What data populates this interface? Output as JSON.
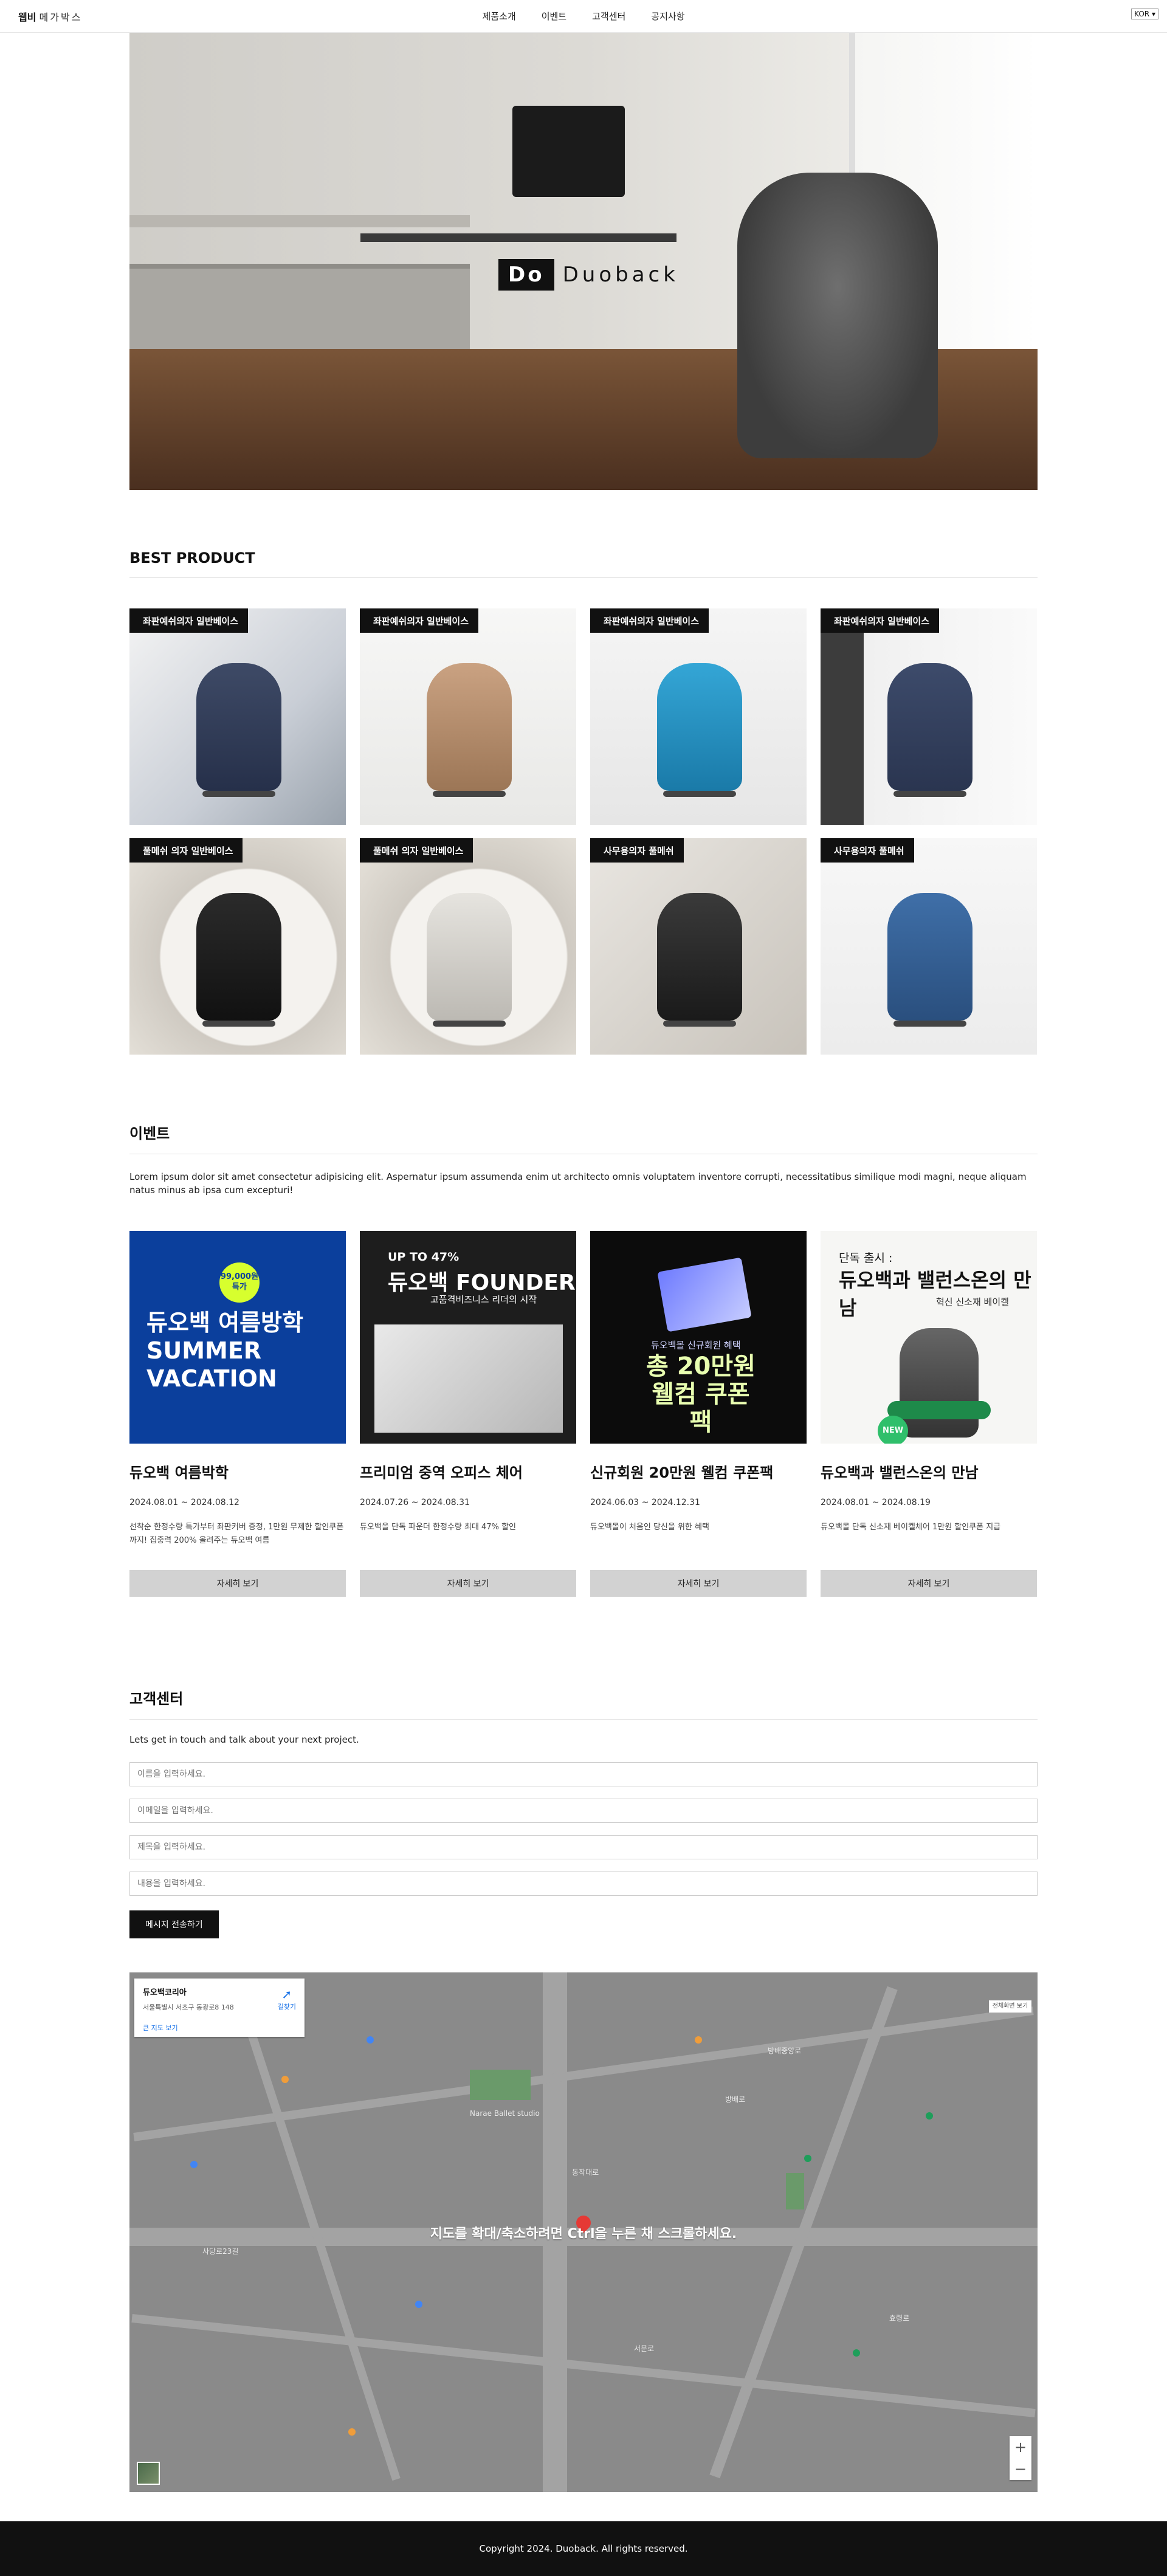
{
  "header": {
    "logo_bold": "웹비",
    "logo_rest": "메가박스",
    "nav": [
      {
        "label": "제품소개"
      },
      {
        "label": "이벤트"
      },
      {
        "label": "고객센터"
      },
      {
        "label": "공지사항"
      }
    ],
    "language": "KOR"
  },
  "hero": {
    "badge_box": "Do",
    "badge_word": "Duoback"
  },
  "best_products": {
    "title": "BEST PRODUCT",
    "items": [
      {
        "tag": "좌판예쉬의자 일반베이스"
      },
      {
        "tag": "좌판예쉬의자 일반베이스"
      },
      {
        "tag": "좌판예쉬의자 일반베이스"
      },
      {
        "tag": "좌판예쉬의자 일반베이스"
      },
      {
        "tag": "풀메쉬 의자 일반베이스"
      },
      {
        "tag": "풀메쉬 의자 일반베이스"
      },
      {
        "tag": "사무용의자 풀메쉬"
      },
      {
        "tag": "사무용의자 풀메쉬"
      }
    ]
  },
  "events": {
    "title": "이벤트",
    "description": "Lorem ipsum dolor sit amet consectetur adipisicing elit. Aspernatur ipsum assumenda enim ut architecto omnis voluptatem inventore corrupti, necessitatibus similique modi magni, neque aliquam natus minus ab ipsa cum excepturi!",
    "items": [
      {
        "title": "듀오백 여름박학",
        "date": "2024.08.01 ~ 2024.08.12",
        "text": "선착순 한정수량 특가부터 좌판커버 증정, 1만원 무제한 할인쿠폰까지! 집중력 200% 올려주는 듀오백 여름",
        "button": "자세히 보기",
        "img_badge": "99,000원 특가",
        "img_big": "듀오백 여름방학 SUMMER VACATION"
      },
      {
        "title": "프리미엄 중역 오피스 체어",
        "date": "2024.07.26 ~ 2024.08.31",
        "text": "듀오백을 단독 파운더 한정수량 최대 47% 할인",
        "button": "자세히 보기",
        "img_top": "UP TO 47%",
        "img_big": "듀오백 FOUNDER",
        "img_sub": "고품격비즈니스 리더의 시작"
      },
      {
        "title": "신규회원 20만원 웰컴 쿠폰팩",
        "date": "2024.06.03 ~ 2024.12.31",
        "text": "듀오백몰이 처음인 당신을 위한 혜택",
        "button": "자세히 보기",
        "img_sub": "듀오백몰 신규회원 혜택",
        "img_big": "총 20만원 웰컴 쿠폰팩"
      },
      {
        "title": "듀오백과 밸런스온의 만남",
        "date": "2024.08.01 ~ 2024.08.19",
        "text": "듀오백몰 단독 신소재 베이켈체어 1만원 할인쿠폰 지급",
        "button": "자세히 보기",
        "img_top": "단독 출시 :",
        "img_big": "듀오백과 밸런스온의 만남",
        "img_sub": "혁신 신소재 베이켈",
        "img_new": "NEW"
      }
    ]
  },
  "customer_center": {
    "title": "고객센터",
    "description": "Lets get in touch and talk about your next project.",
    "fields": [
      {
        "placeholder": "이름을 입력하세요."
      },
      {
        "placeholder": "이메일을 입력하세요."
      },
      {
        "placeholder": "제목을 입력하세요."
      },
      {
        "placeholder": "내용을 입력하세요."
      }
    ],
    "submit": "메시지 전송하기"
  },
  "map": {
    "place_name": "듀오백코리아",
    "address": "서울특별시 서초구 동광로8 148",
    "directions": "길찾기",
    "larger_map": "큰 지도 보기",
    "overlay": "지도를 확대/축소하려면 Ctrl을 누른 채 스크롤하세요.",
    "fullscreen": "전체화면 보기",
    "zoom_in": "+",
    "zoom_out": "−",
    "labels": [
      {
        "text": "Narae Ballet studio"
      },
      {
        "text": "동작대로"
      },
      {
        "text": "방배로"
      },
      {
        "text": "서문로"
      },
      {
        "text": "사당로23길"
      },
      {
        "text": "방배중앙로"
      },
      {
        "text": "효령로"
      }
    ]
  },
  "footer": {
    "copyright": "Copyright 2024. Duoback. All rights reserved."
  }
}
